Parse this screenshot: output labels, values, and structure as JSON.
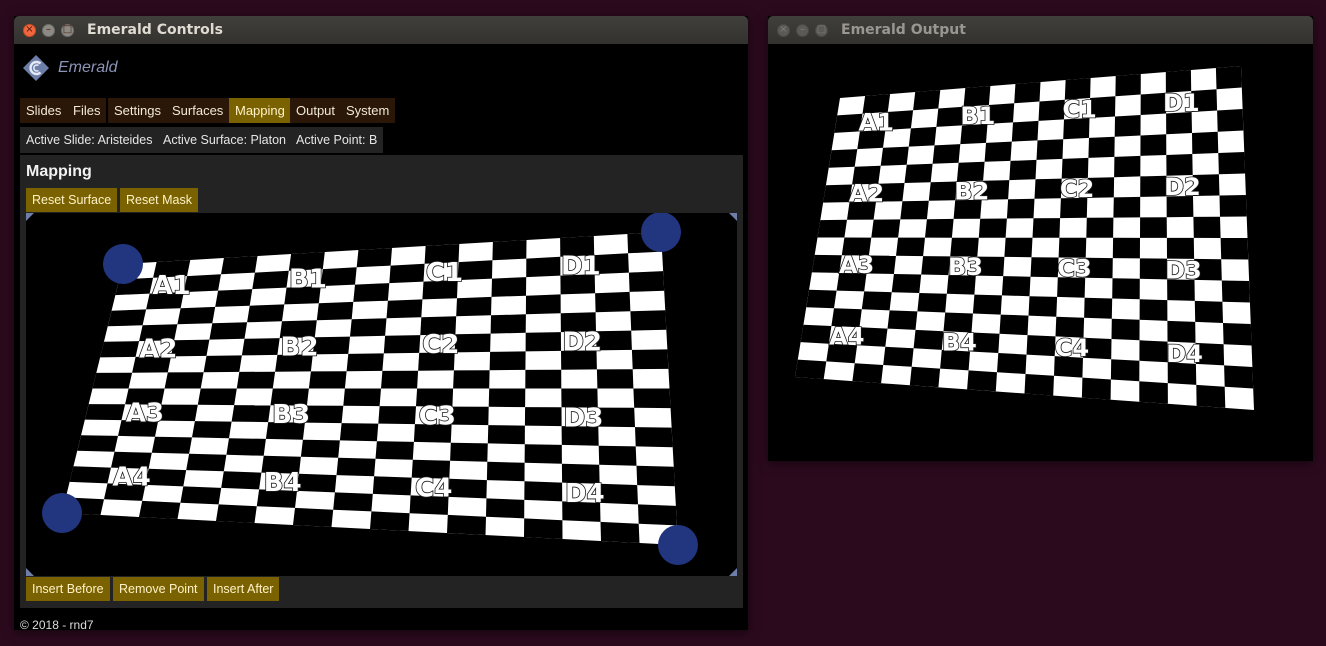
{
  "controls_window": {
    "title": "Emerald Controls",
    "close_glyph": "×",
    "minimize_glyph": "–",
    "maximize_glyph": "□"
  },
  "output_window": {
    "title": "Emerald Output"
  },
  "app": {
    "name": "Emerald",
    "logo_icon": "emerald-logo-icon"
  },
  "tabs": [
    {
      "label": "Slides",
      "active": false
    },
    {
      "label": "Files",
      "active": false
    },
    {
      "label": "Settings",
      "active": false
    },
    {
      "label": "Surfaces",
      "active": false
    },
    {
      "label": "Mapping",
      "active": true
    },
    {
      "label": "Output",
      "active": false
    },
    {
      "label": "System",
      "active": false
    }
  ],
  "status": {
    "active_slide": "Active Slide: Aristeides",
    "active_surface": "Active Surface: Platon",
    "active_point": "Active Point: B"
  },
  "mapping": {
    "title": "Mapping",
    "reset_surface": "Reset Surface",
    "reset_mask": "Reset Mask",
    "insert_before": "Insert Before",
    "remove_point": "Remove Point",
    "insert_after": "Insert After"
  },
  "grid_labels": {
    "columns": [
      "A",
      "B",
      "C",
      "D"
    ],
    "rows": [
      "1",
      "2",
      "3",
      "4"
    ]
  },
  "footer": "© 2018 - rnd7",
  "colors": {
    "tab_bg": "#2a1707",
    "accent": "#7a6200",
    "handle": "#223680",
    "desktop": "#2c0a1e"
  }
}
